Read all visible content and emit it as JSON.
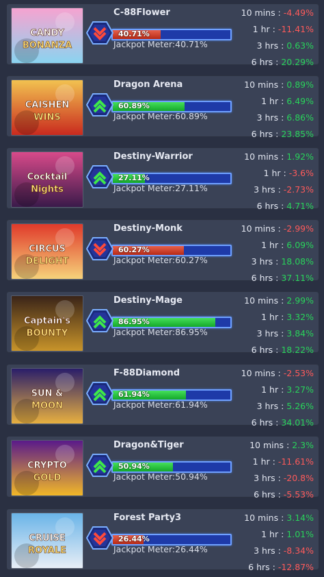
{
  "games": [
    {
      "name": "C-88Flower",
      "art_text": [
        "CANDY",
        "BONANZA"
      ],
      "art_colors": [
        "#f6a3d0",
        "#8ad4f0"
      ],
      "trend": "down",
      "meter": 40.71,
      "meter_pct": "40.71%",
      "meter_label": "Jackpot Meter:40.71%",
      "stats": [
        {
          "label": "10 mins :",
          "value": "-4.49%",
          "sign": "neg"
        },
        {
          "label": "1 hr :",
          "value": "-11.41%",
          "sign": "neg"
        },
        {
          "label": "3 hrs :",
          "value": "0.63%",
          "sign": "pos"
        },
        {
          "label": "6 hrs :",
          "value": "20.29%",
          "sign": "pos"
        }
      ]
    },
    {
      "name": "Dragon Arena",
      "art_text": [
        "CAISHEN",
        "WINS"
      ],
      "art_colors": [
        "#f2c250",
        "#c92a1e"
      ],
      "trend": "up",
      "meter": 60.89,
      "meter_pct": "60.89%",
      "meter_label": "Jackpot Meter:60.89%",
      "stats": [
        {
          "label": "10 mins :",
          "value": "0.89%",
          "sign": "pos"
        },
        {
          "label": "1 hr :",
          "value": "6.49%",
          "sign": "pos"
        },
        {
          "label": "3 hrs :",
          "value": "6.86%",
          "sign": "pos"
        },
        {
          "label": "6 hrs :",
          "value": "23.85%",
          "sign": "pos"
        }
      ]
    },
    {
      "name": "Destiny-Warrior",
      "art_text": [
        "Cocktail",
        "Nights"
      ],
      "art_colors": [
        "#d84a8a",
        "#3a1a4a"
      ],
      "trend": "up",
      "meter": 27.11,
      "meter_pct": "27.11%",
      "meter_label": "Jackpot Meter:27.11%",
      "stats": [
        {
          "label": "10 mins :",
          "value": "1.92%",
          "sign": "pos"
        },
        {
          "label": "1 hr :",
          "value": "-3.6%",
          "sign": "neg"
        },
        {
          "label": "3 hrs :",
          "value": "-2.73%",
          "sign": "neg"
        },
        {
          "label": "6 hrs :",
          "value": "4.71%",
          "sign": "pos"
        }
      ]
    },
    {
      "name": "Destiny-Monk",
      "art_text": [
        "CIRCUS",
        "DELIGHT"
      ],
      "art_colors": [
        "#e03a2a",
        "#f6d27a"
      ],
      "trend": "down",
      "meter": 60.27,
      "meter_pct": "60.27%",
      "meter_label": "Jackpot Meter:60.27%",
      "stats": [
        {
          "label": "10 mins :",
          "value": "-2.99%",
          "sign": "neg"
        },
        {
          "label": "1 hr :",
          "value": "6.09%",
          "sign": "pos"
        },
        {
          "label": "3 hrs :",
          "value": "18.08%",
          "sign": "pos"
        },
        {
          "label": "6 hrs :",
          "value": "37.11%",
          "sign": "pos"
        }
      ]
    },
    {
      "name": "Destiny-Mage",
      "art_text": [
        "Captain's",
        "BOUNTY"
      ],
      "art_colors": [
        "#3a2418",
        "#c8942a"
      ],
      "trend": "up",
      "meter": 86.95,
      "meter_pct": "86.95%",
      "meter_label": "Jackpot Meter:86.95%",
      "stats": [
        {
          "label": "10 mins :",
          "value": "2.99%",
          "sign": "pos"
        },
        {
          "label": "1 hr :",
          "value": "3.32%",
          "sign": "pos"
        },
        {
          "label": "3 hrs :",
          "value": "3.84%",
          "sign": "pos"
        },
        {
          "label": "6 hrs :",
          "value": "18.22%",
          "sign": "pos"
        }
      ]
    },
    {
      "name": "F-88Diamond",
      "art_text": [
        "SUN &",
        "MOON"
      ],
      "art_colors": [
        "#2a1e6a",
        "#e8b040"
      ],
      "trend": "up",
      "meter": 61.94,
      "meter_pct": "61.94%",
      "meter_label": "Jackpot Meter:61.94%",
      "stats": [
        {
          "label": "10 mins :",
          "value": "-2.53%",
          "sign": "neg"
        },
        {
          "label": "1 hr :",
          "value": "3.27%",
          "sign": "pos"
        },
        {
          "label": "3 hrs :",
          "value": "5.26%",
          "sign": "pos"
        },
        {
          "label": "6 hrs :",
          "value": "34.01%",
          "sign": "pos"
        }
      ]
    },
    {
      "name": "Dragon&Tiger",
      "art_text": [
        "CRYPTO",
        "GOLD"
      ],
      "art_colors": [
        "#5a1a8a",
        "#f2b828"
      ],
      "trend": "up",
      "meter": 50.94,
      "meter_pct": "50.94%",
      "meter_label": "Jackpot Meter:50.94%",
      "stats": [
        {
          "label": "10 mins :",
          "value": "2.3%",
          "sign": "pos"
        },
        {
          "label": "1 hr :",
          "value": "-11.61%",
          "sign": "neg"
        },
        {
          "label": "3 hrs :",
          "value": "-20.8%",
          "sign": "neg"
        },
        {
          "label": "6 hrs :",
          "value": "-5.53%",
          "sign": "neg"
        }
      ]
    },
    {
      "name": "Forest Party3",
      "art_text": [
        "CRUISE",
        "ROYALE"
      ],
      "art_colors": [
        "#6ab4e8",
        "#e8eef6"
      ],
      "trend": "down",
      "meter": 26.44,
      "meter_pct": "26.44%",
      "meter_label": "Jackpot Meter:26.44%",
      "stats": [
        {
          "label": "10 mins :",
          "value": "3.14%",
          "sign": "pos"
        },
        {
          "label": "1 hr :",
          "value": "1.01%",
          "sign": "pos"
        },
        {
          "label": "3 hrs :",
          "value": "-8.34%",
          "sign": "neg"
        },
        {
          "label": "6 hrs :",
          "value": "-12.87%",
          "sign": "neg"
        }
      ]
    }
  ]
}
